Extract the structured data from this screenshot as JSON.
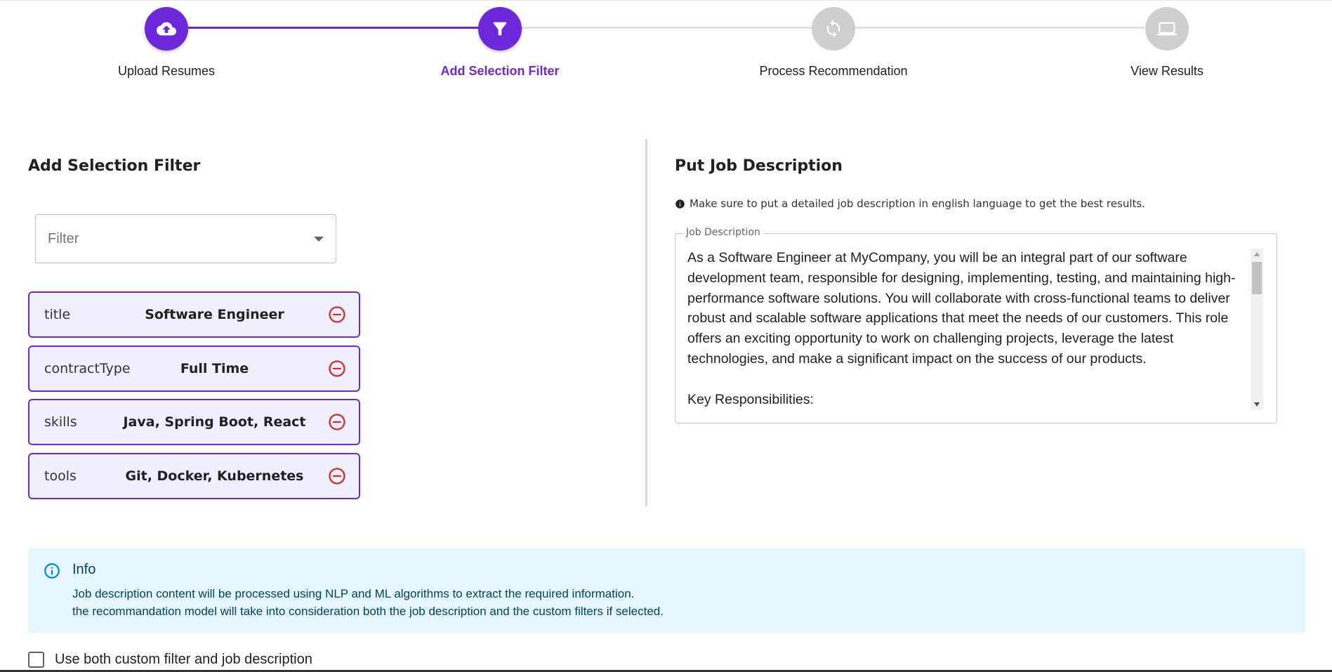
{
  "stepper": {
    "steps": [
      {
        "label": "Upload Resumes",
        "icon": "cloud-upload-icon",
        "state": "completed"
      },
      {
        "label": "Add Selection Filter",
        "icon": "filter-icon",
        "state": "active"
      },
      {
        "label": "Process Recommendation",
        "icon": "refresh-icon",
        "state": "pending"
      },
      {
        "label": "View Results",
        "icon": "monitor-icon",
        "state": "pending"
      }
    ],
    "active_color": "#6d28d9",
    "inactive_color": "#cfcfcf"
  },
  "filters": {
    "title": "Add Selection Filter",
    "select": {
      "placeholder": "Filter"
    },
    "chips": [
      {
        "key": "title",
        "value": "Software Engineer"
      },
      {
        "key": "contractType",
        "value": "Full Time"
      },
      {
        "key": "skills",
        "value": "Java, Spring Boot, React"
      },
      {
        "key": "tools",
        "value": "Git, Docker, Kubernetes"
      }
    ],
    "remove_icon_color": "#d32f2f"
  },
  "job_description": {
    "title": "Put Job Description",
    "hint": "Make sure to put a detailed job description in english language to get the best results.",
    "field_label": "Job Description",
    "value": "As a Software Engineer at MyCompany, you will be an integral part of our software development team, responsible for designing, implementing, testing, and maintaining high-performance software solutions. You will collaborate with cross-functional teams to deliver robust and scalable software applications that meet the needs of our customers. This role offers an exciting opportunity to work on challenging projects, leverage the latest technologies, and make a significant impact on the success of our products.\n\nKey Responsibilities:"
  },
  "info": {
    "title": "Info",
    "line1": "Job description content will be processed using NLP and ML algorithms to extract the required information.",
    "line2": "the recommandation model will take into consideration both the job description and the custom filters if selected.",
    "color": "#014361",
    "background": "#e5f6fd"
  },
  "options": {
    "use_both_label": "Use both custom filter and job description",
    "use_both_checked": false
  }
}
